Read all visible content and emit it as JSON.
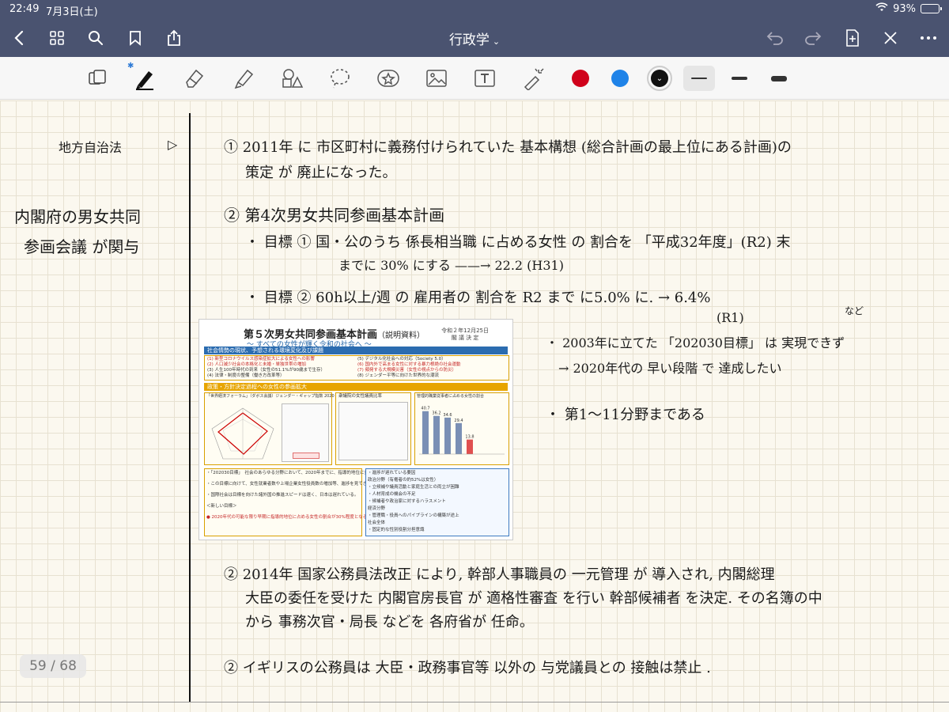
{
  "status_bar": {
    "time": "22:49",
    "date": "7月3日(土)",
    "battery": "93%",
    "battery_level": 0.93
  },
  "nav": {
    "title": "行政学",
    "title_chevron": "⌄"
  },
  "toolbar": {
    "tools": [
      "read-mode-icon",
      "pen-icon",
      "eraser-icon",
      "highlighter-icon",
      "shapes-icon",
      "lasso-icon",
      "sticker-icon",
      "image-icon",
      "text-icon",
      "laser-pointer-icon"
    ],
    "colors": [
      "#d0021b",
      "#1f83e8",
      "#111111"
    ],
    "selected_color_marker": "⌄"
  },
  "notes": {
    "side_title": "地方自治法",
    "side_arrow": "▷",
    "side_note_1": "内閣府の男女共同",
    "side_note_2": "参画会議 が関与",
    "n1_line1": "① 2011年 に 市区町村に義務付けられていた 基本構想 (総合計画の最上位にある計画)の",
    "n1_line2": "策定 が 廃止になった。",
    "n2_heading": "② 第4次男女共同参画基本計画",
    "n2_goal1_line1": "・ 目標 ① 国・公のうち 係長相当職 に占める女性 の 割合を 「平成32年度」(R2) 末",
    "n2_goal1_line2": "までに 30% にする  ——→  22.2 (H31)",
    "n2_goal2": "・ 目標 ② 60h以上/週 の 雇用者の 割合を R2 まで に5.0% に. → 6.4%",
    "n2_goal2_note": "(R1)",
    "nado": "など",
    "r_line1": "・ 2003年に立てた 「202030目標」 は 実現できず",
    "r_line2": "→ 2020年代の 早い段階 で 達成したい",
    "r_line3": "・ 第1〜11分野まである",
    "n3_line1": "② 2014年 国家公務員法改正 により, 幹部人事職員の 一元管理 が 導入され, 内閣総理",
    "n3_line2": "大臣の委任を受けた 内閣官房長官 が 適格性審査 を行い 幹部候補者 を決定. その名簿の中",
    "n3_line3": "から 事務次官・局長 などを 各府省が 任命。",
    "n4_line1": "② イギリスの公務員は 大臣・政務事官等 以外の 与党議員との 接触は禁止 ."
  },
  "slide": {
    "title": "第５次男女共同参画基本計画",
    "title_suffix": "（説明資料）",
    "subtitle": "～ すべての女性が輝く令和の社会へ ～",
    "stamp_line1": "令和２年12月25日",
    "stamp_line2": "閣 議 決 定",
    "band1": "社会情勢の現状、予想される環境変化及び課題",
    "left_items": [
      "(1) 新型コロナウイルス感染症拡大による女性への影響",
      "(2) 人口減少社会の本格化と未婚・単独世帯の増加",
      "(3) 人生100年時代の到来（女性の51.1%が90歳まで生存）",
      "(4) 法律・制度の整備（働き方改革等）"
    ],
    "right_items": [
      "(5) デジタル化社会への対応（Society 5.0）",
      "(6) 国内外で高まる女性に対する暴力根絶の社会運動",
      "(7) 頻発する大規模災害（女性の視点からの防災）",
      "(8) ジェンダー平等に向けた世界的な潮流"
    ],
    "band2": "政策・方針決定過程への女性の参画拡大",
    "col1_title": "「世界経済フォーラム」（ダボス会議）ジェンダー・ギャップ指数 2020  153か国中 121位",
    "col2_title": "衆議院の女性議員比率",
    "col3_title": "管理的職業従事者に占める女性の割合",
    "bar_values": [
      "40.7",
      "36.2",
      "34.6",
      "29.4",
      "13.8"
    ],
    "bottom_left": [
      "・「202030目標」　社会のあらゆる分野において、2020年までに、指導的地位に女性が占める割合が、少なくとも30%程度となるよう期待する",
      "・この目標に向けて、女性就業者数や上場企業女性役員数の増加等、進捗を見てきたが、全体として「30%」の水準に到達しそうとは言えない状況。",
      "・国際社会は目標を向けた諸外国の推進スピードは速く、日本は遅れている。",
      "＜新しい目標＞",
      "● 2020年代の可能な限り早期に指導的地位に占める女性の割合が30%程度となるよう目指して取組を進める。"
    ],
    "bottom_right": [
      "・進捗が遅れている要因",
      "政治分野（有権者の約52%は女性）",
      "・立候補や議員活動と家庭生活との両立が困難",
      "・人材育成の機会の不足",
      "・候補者や政治家に対するハラスメント",
      "経済分野",
      "・管理職・役員へのパイプラインの構築が途上",
      "社会全体",
      "・固定的な性別役割分担意識"
    ]
  },
  "page_indicator": "59 / 68"
}
